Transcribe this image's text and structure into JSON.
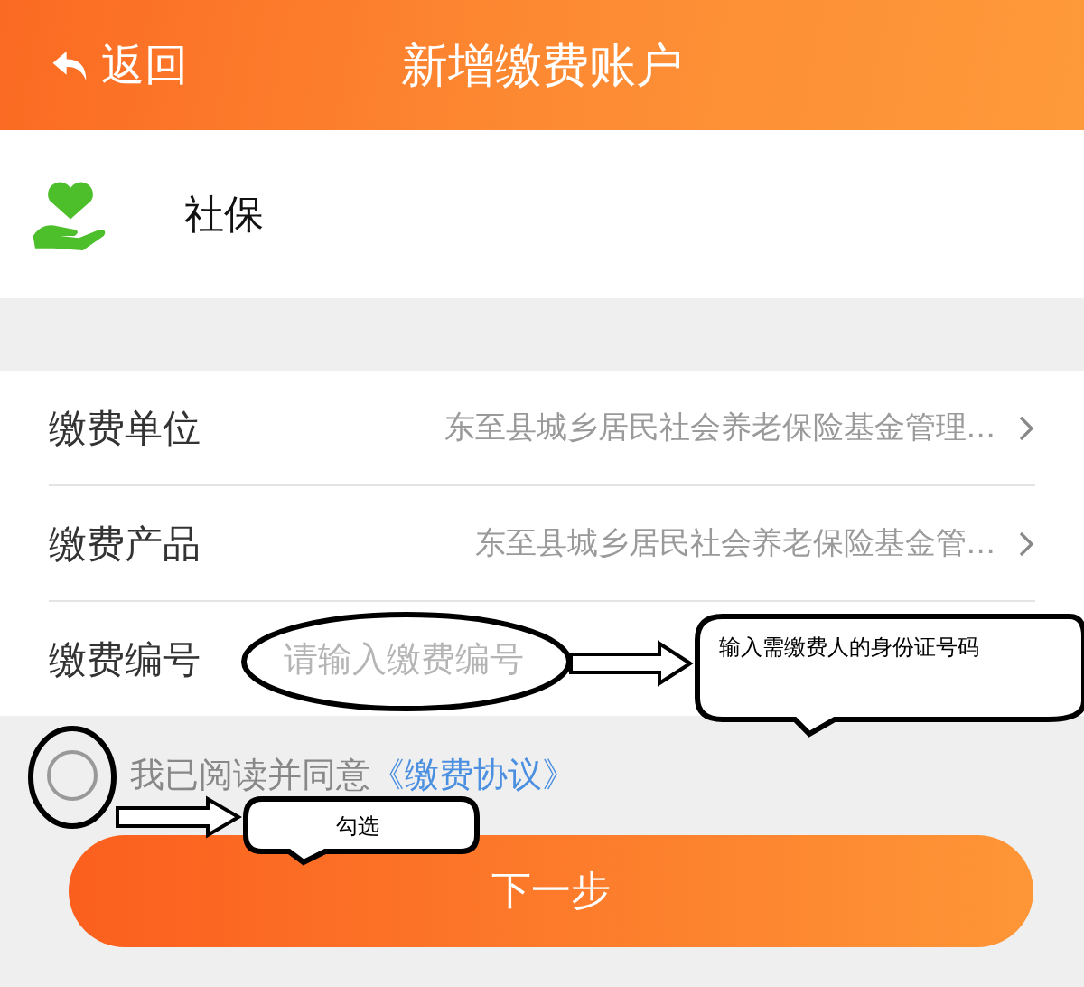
{
  "header": {
    "back": "返回",
    "title": "新增缴费账户"
  },
  "category": {
    "label": "社保"
  },
  "form": [
    {
      "kind": "select",
      "label": "缴费单位",
      "value": "东至县城乡居民社会养老保险基金管理..."
    },
    {
      "kind": "select",
      "label": "缴费产品",
      "value": "东至县城乡居民社会养老保险基金管..."
    },
    {
      "kind": "input",
      "label": "缴费编号",
      "placeholder": "请输入缴费编号"
    }
  ],
  "agreement": {
    "checked": false,
    "text": "我已阅读并同意",
    "link": "《缴费协议》"
  },
  "next_button": "下一步",
  "annotations": [
    {
      "text": "输入需缴费人的身份证号码"
    },
    {
      "text": "勾选"
    }
  ]
}
